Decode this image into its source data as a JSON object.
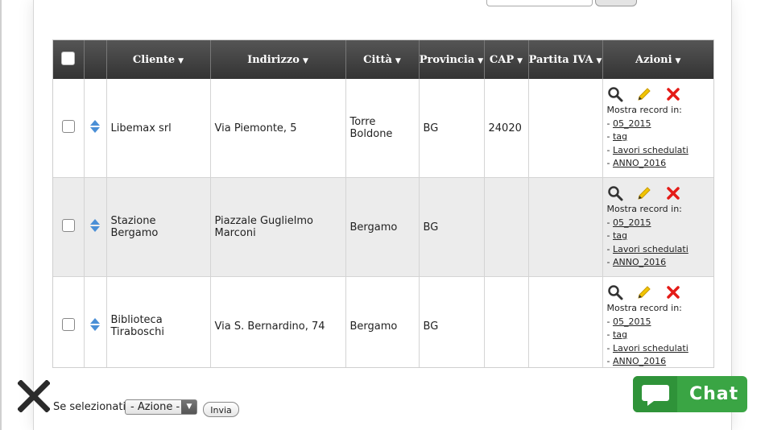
{
  "table": {
    "columns": [
      {
        "key": "cliente",
        "label": "Cliente"
      },
      {
        "key": "indirizzo",
        "label": "Indirizzo"
      },
      {
        "key": "citta",
        "label": "Città"
      },
      {
        "key": "provincia",
        "label": "Provincia"
      },
      {
        "key": "cap",
        "label": "CAP"
      },
      {
        "key": "piva",
        "label": "Partita IVA"
      },
      {
        "key": "azioni",
        "label": "Azioni"
      }
    ],
    "rows": [
      {
        "cliente": "Libemax srl",
        "indirizzo": "Via Piemonte, 5",
        "citta": "Torre Boldone",
        "provincia": "BG",
        "cap": "24020",
        "piva": ""
      },
      {
        "cliente": "Stazione Bergamo",
        "indirizzo": "Piazzale Guglielmo Marconi",
        "citta": "Bergamo",
        "provincia": "BG",
        "cap": "",
        "piva": ""
      },
      {
        "cliente": "Biblioteca Tiraboschi",
        "indirizzo": "Via S. Bernardino, 74",
        "citta": "Bergamo",
        "provincia": "BG",
        "cap": "",
        "piva": ""
      }
    ],
    "record_label": "Mostra record in:",
    "record_links": [
      "05_2015",
      "tag",
      "Lavori schedulati",
      "ANNO_2016"
    ],
    "link_prefix": "- "
  },
  "footer": {
    "selected_label": "Se selezionati:",
    "action_select_value": "- Azione -",
    "submit_label": "Invia"
  },
  "chat": {
    "label": "Chat"
  },
  "colors": {
    "header_bg": "#3d3d3d",
    "chat_green": "#3aa544",
    "delete_red": "#e41b17",
    "edit_yellow": "#f2c500",
    "sort_blue": "#4a8fd6"
  }
}
